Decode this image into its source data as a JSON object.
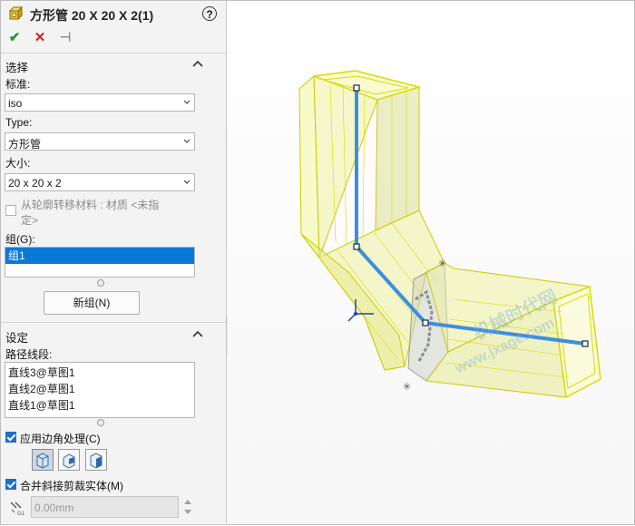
{
  "window": {
    "title": "方形管 20 X 20 X 2(1)",
    "help": "?"
  },
  "actions": {
    "ok": "✔",
    "cancel": "✕",
    "pin": "⊣"
  },
  "selection": {
    "header": "选择",
    "standard": {
      "label": "标准:",
      "value": "iso"
    },
    "type": {
      "label": "Type:",
      "value": "方形管"
    },
    "size": {
      "label": "大小:",
      "value": "20 x 20 x 2"
    },
    "transfer_material": {
      "label_line1": "从轮廓转移材料 : 材质 <未指",
      "label_line2": "定>",
      "checked": false
    },
    "group": {
      "label": "组(G):",
      "items": [
        "组1"
      ],
      "selected": "组1"
    },
    "new_group_button": "新组(N)"
  },
  "settings": {
    "header": "设定",
    "path_label": "路径线段:",
    "path_segments": [
      "直线3@草图1",
      "直线2@草图1",
      "直线1@草图1"
    ],
    "apply_corner": {
      "label": "应用边角处理(C)",
      "checked": true
    },
    "merge_miter": {
      "label": "合并斜接剪裁实体(M)",
      "checked": true
    },
    "gap": {
      "value": "0.00mm",
      "icon": "gap-icon"
    }
  },
  "watermark": {
    "line1": "机械时代网",
    "line2": "www.jxage.com"
  },
  "colors": {
    "accent": "#0a78d7",
    "tube_fill": "#f4f7a0",
    "tube_edge": "#d8dc00",
    "path_line": "#3c8fe0"
  }
}
